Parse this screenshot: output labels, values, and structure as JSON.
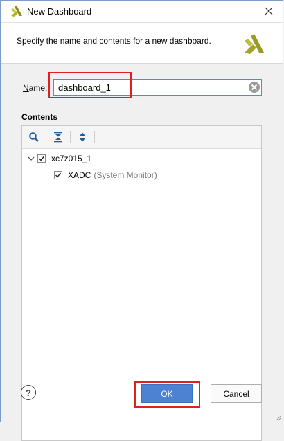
{
  "window": {
    "title": "New Dashboard",
    "logo_icon": "xilinx-logo-icon",
    "close_icon": "close-icon"
  },
  "header": {
    "description": "Specify the name and contents for a new dashboard."
  },
  "name_field": {
    "label_mnemonic": "N",
    "label_rest": "ame:",
    "value": "dashboard_1",
    "clear_icon": "clear-icon"
  },
  "contents": {
    "label": "Contents",
    "toolbar": {
      "icons": [
        "search-icon",
        "collapse-all-icon",
        "expand-all-icon"
      ]
    },
    "tree": [
      {
        "label": "xc7z015_1",
        "checked": true,
        "expanded": true,
        "children": [
          {
            "label": "XADC",
            "detail": "(System Monitor)",
            "checked": true
          }
        ]
      }
    ]
  },
  "footer": {
    "help_label": "?",
    "ok_label": "OK",
    "cancel_label": "Cancel"
  },
  "colors": {
    "accent": "#4d82d3",
    "highlight": "#e02020",
    "logo": "#a3a32a"
  }
}
